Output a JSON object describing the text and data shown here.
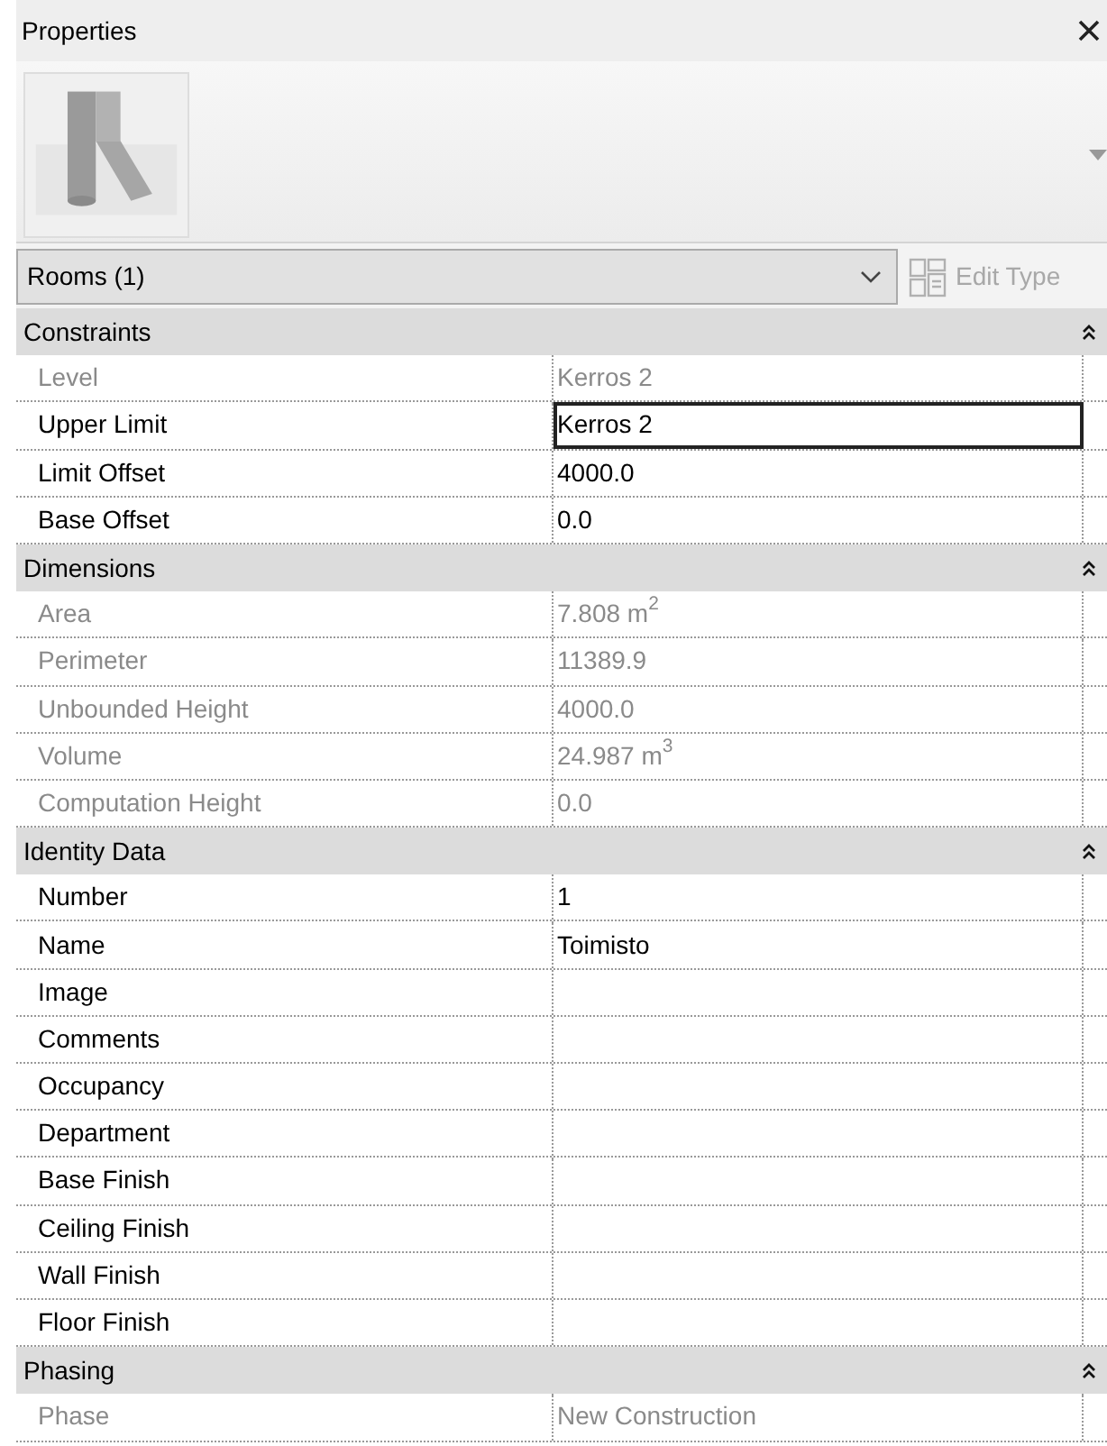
{
  "window": {
    "title": "Properties"
  },
  "type_selector": {
    "value": "Rooms (1)"
  },
  "edit_type": {
    "label": "Edit Type",
    "disabled": true
  },
  "groups": [
    {
      "title": "Constraints",
      "expanded": true,
      "rows": [
        {
          "label": "Level",
          "value": "Kerros 2",
          "editable": false,
          "selected": false
        },
        {
          "label": "Upper Limit",
          "value": "Kerros 2",
          "editable": true,
          "selected": true
        },
        {
          "label": "Limit Offset",
          "value": "4000.0",
          "editable": true,
          "selected": false
        },
        {
          "label": "Base Offset",
          "value": "0.0",
          "editable": true,
          "selected": false
        }
      ]
    },
    {
      "title": "Dimensions",
      "expanded": true,
      "rows": [
        {
          "label": "Area",
          "value": "7.808 m$^{2}$",
          "editable": false,
          "selected": false
        },
        {
          "label": "Perimeter",
          "value": "11389.9",
          "editable": false,
          "selected": false
        },
        {
          "label": "Unbounded Height",
          "value": "4000.0",
          "editable": false,
          "selected": false
        },
        {
          "label": "Volume",
          "value": "24.987 m$^{3}$",
          "editable": false,
          "selected": false
        },
        {
          "label": "Computation Height",
          "value": "0.0",
          "editable": false,
          "selected": false
        }
      ]
    },
    {
      "title": "Identity Data",
      "expanded": true,
      "rows": [
        {
          "label": "Number",
          "value": "1",
          "editable": true,
          "selected": false
        },
        {
          "label": "Name",
          "value": "Toimisto",
          "editable": true,
          "selected": false
        },
        {
          "label": "Image",
          "editable": true,
          "selected": false
        },
        {
          "label": "Comments",
          "editable": true,
          "selected": false
        },
        {
          "label": "Occupancy",
          "editable": true,
          "selected": false
        },
        {
          "label": "Department",
          "editable": true,
          "selected": false
        },
        {
          "label": "Base Finish",
          "editable": true,
          "selected": false
        },
        {
          "label": "Ceiling Finish",
          "editable": true,
          "selected": false
        },
        {
          "label": "Wall Finish",
          "editable": true,
          "selected": false
        },
        {
          "label": "Floor Finish",
          "editable": true,
          "selected": false
        }
      ]
    },
    {
      "title": "Phasing",
      "expanded": true,
      "rows": [
        {
          "label": "Phase",
          "value": "New Construction",
          "editable": false,
          "selected": false
        }
      ]
    }
  ]
}
